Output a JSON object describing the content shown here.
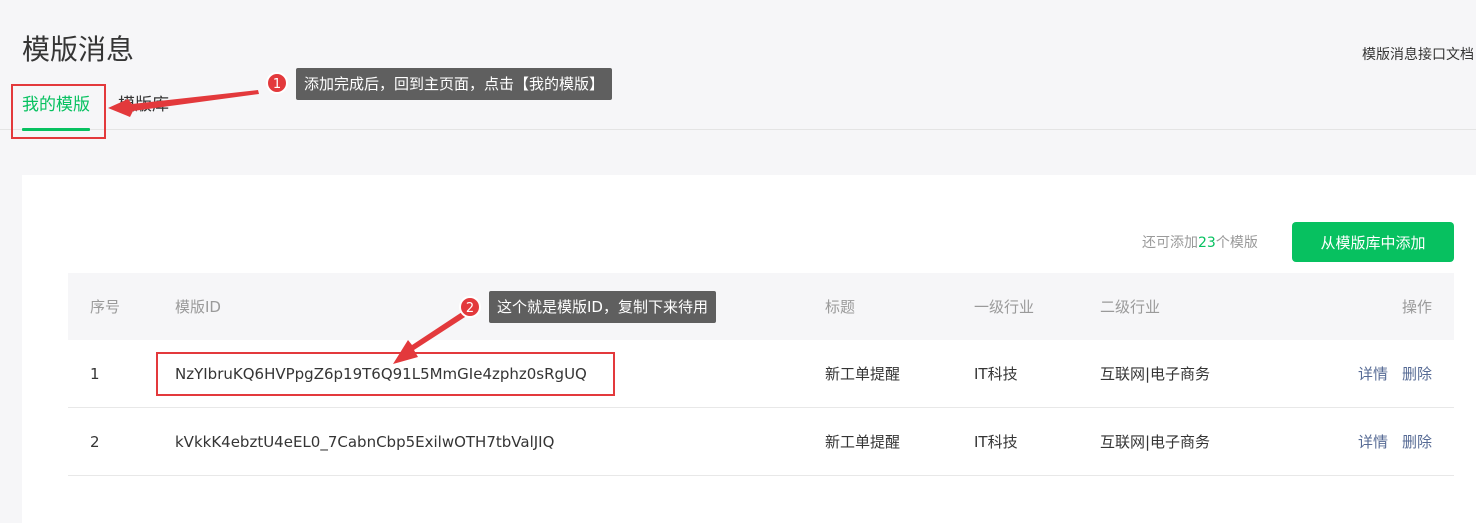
{
  "page": {
    "title": "模版消息",
    "doc_link": "模版消息接口文档"
  },
  "tabs": [
    {
      "label": "我的模版",
      "active": true
    },
    {
      "label": "模版库",
      "active": false
    }
  ],
  "toolbar": {
    "remaining_prefix": "还可添加",
    "remaining_count": "23",
    "remaining_suffix": "个模版",
    "add_button": "从模版库中添加"
  },
  "table": {
    "headers": [
      "序号",
      "模版ID",
      "标题",
      "一级行业",
      "二级行业",
      "操作"
    ],
    "rows": [
      {
        "no": "1",
        "id": "NzYIbruKQ6HVPpgZ6p19T6Q91L5MmGIe4zphz0sRgUQ",
        "title": "新工单提醒",
        "industry1": "IT科技",
        "industry2": "互联网|电子商务",
        "op_detail": "详情",
        "op_delete": "删除"
      },
      {
        "no": "2",
        "id": "kVkkK4ebztU4eEL0_7CabnCbp5ExilwOTH7tbValJIQ",
        "title": "新工单提醒",
        "industry1": "IT科技",
        "industry2": "互联网|电子商务",
        "op_detail": "详情",
        "op_delete": "删除"
      }
    ]
  },
  "annotations": {
    "step1": {
      "number": "1",
      "text": "添加完成后，回到主页面，点击【我的模版】"
    },
    "step2": {
      "number": "2",
      "text": "这个就是模版ID，复制下来待用"
    },
    "colors": {
      "highlight": "#e3393c",
      "callout_bg": "#5f5f5f",
      "accent": "#07c160",
      "link": "#576b95"
    }
  }
}
